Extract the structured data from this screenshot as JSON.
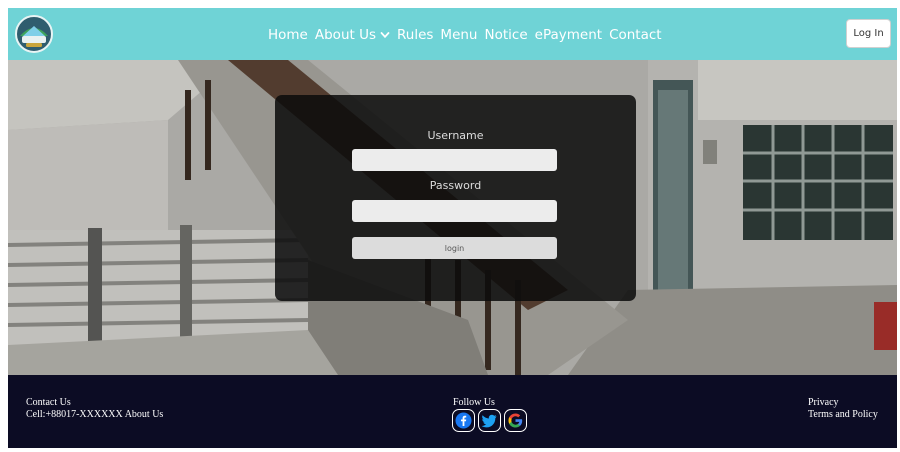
{
  "navbar": {
    "links": [
      {
        "label": "Home"
      },
      {
        "label": "About Us",
        "has_dropdown": true
      },
      {
        "label": "Rules"
      },
      {
        "label": "Menu"
      },
      {
        "label": "Notice"
      },
      {
        "label": "ePayment"
      },
      {
        "label": "Contact"
      }
    ],
    "login_button": "Log In",
    "bg_color": "#6fd3d6"
  },
  "login_form": {
    "username_label": "Username",
    "username_value": "",
    "password_label": "Password",
    "password_value": "",
    "submit_label": "login"
  },
  "footer": {
    "contact_heading": "Contact Us",
    "contact_line": "Cell:+88017-XXXXXX About Us",
    "follow_heading": "Follow Us",
    "social_icons": [
      "facebook-icon",
      "twitter-icon",
      "google-icon"
    ],
    "privacy_label": "Privacy",
    "terms_label": "Terms and Policy",
    "bg_color": "#0c0c24"
  }
}
